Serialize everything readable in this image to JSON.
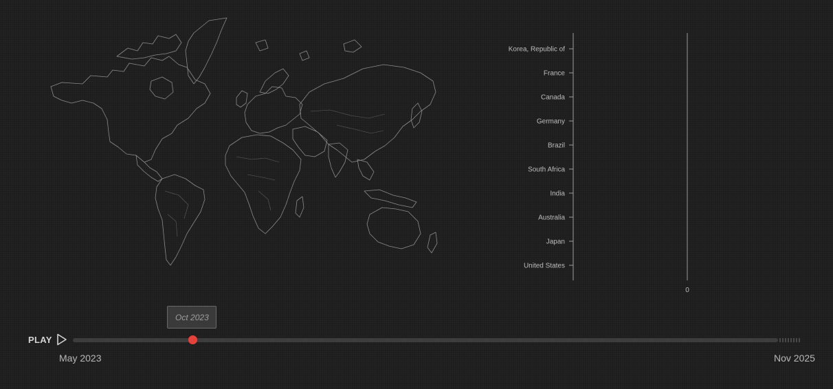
{
  "chart_data": {
    "type": "bar",
    "orientation": "horizontal",
    "categories": [
      "Korea, Republic of",
      "France",
      "Canada",
      "Germany",
      "Brazil",
      "South Africa",
      "India",
      "Australia",
      "Japan",
      "United States"
    ],
    "values": [
      0,
      0,
      0,
      0,
      0,
      0,
      0,
      0,
      0,
      0
    ],
    "x_ticks": [
      "0"
    ],
    "xlim": [
      0,
      1
    ],
    "grid": false,
    "title": "",
    "xlabel": "",
    "ylabel": ""
  },
  "timeline": {
    "play_label": "PLAY",
    "start_label": "May 2023",
    "end_label": "Nov 2025",
    "current_label": "Oct 2023",
    "progress": 0.17
  },
  "colors": {
    "accent": "#e8413b",
    "map_stroke": "#8d8d8d",
    "background": "#1d1d1d"
  },
  "icons": {
    "play": "play-triangle-icon"
  }
}
